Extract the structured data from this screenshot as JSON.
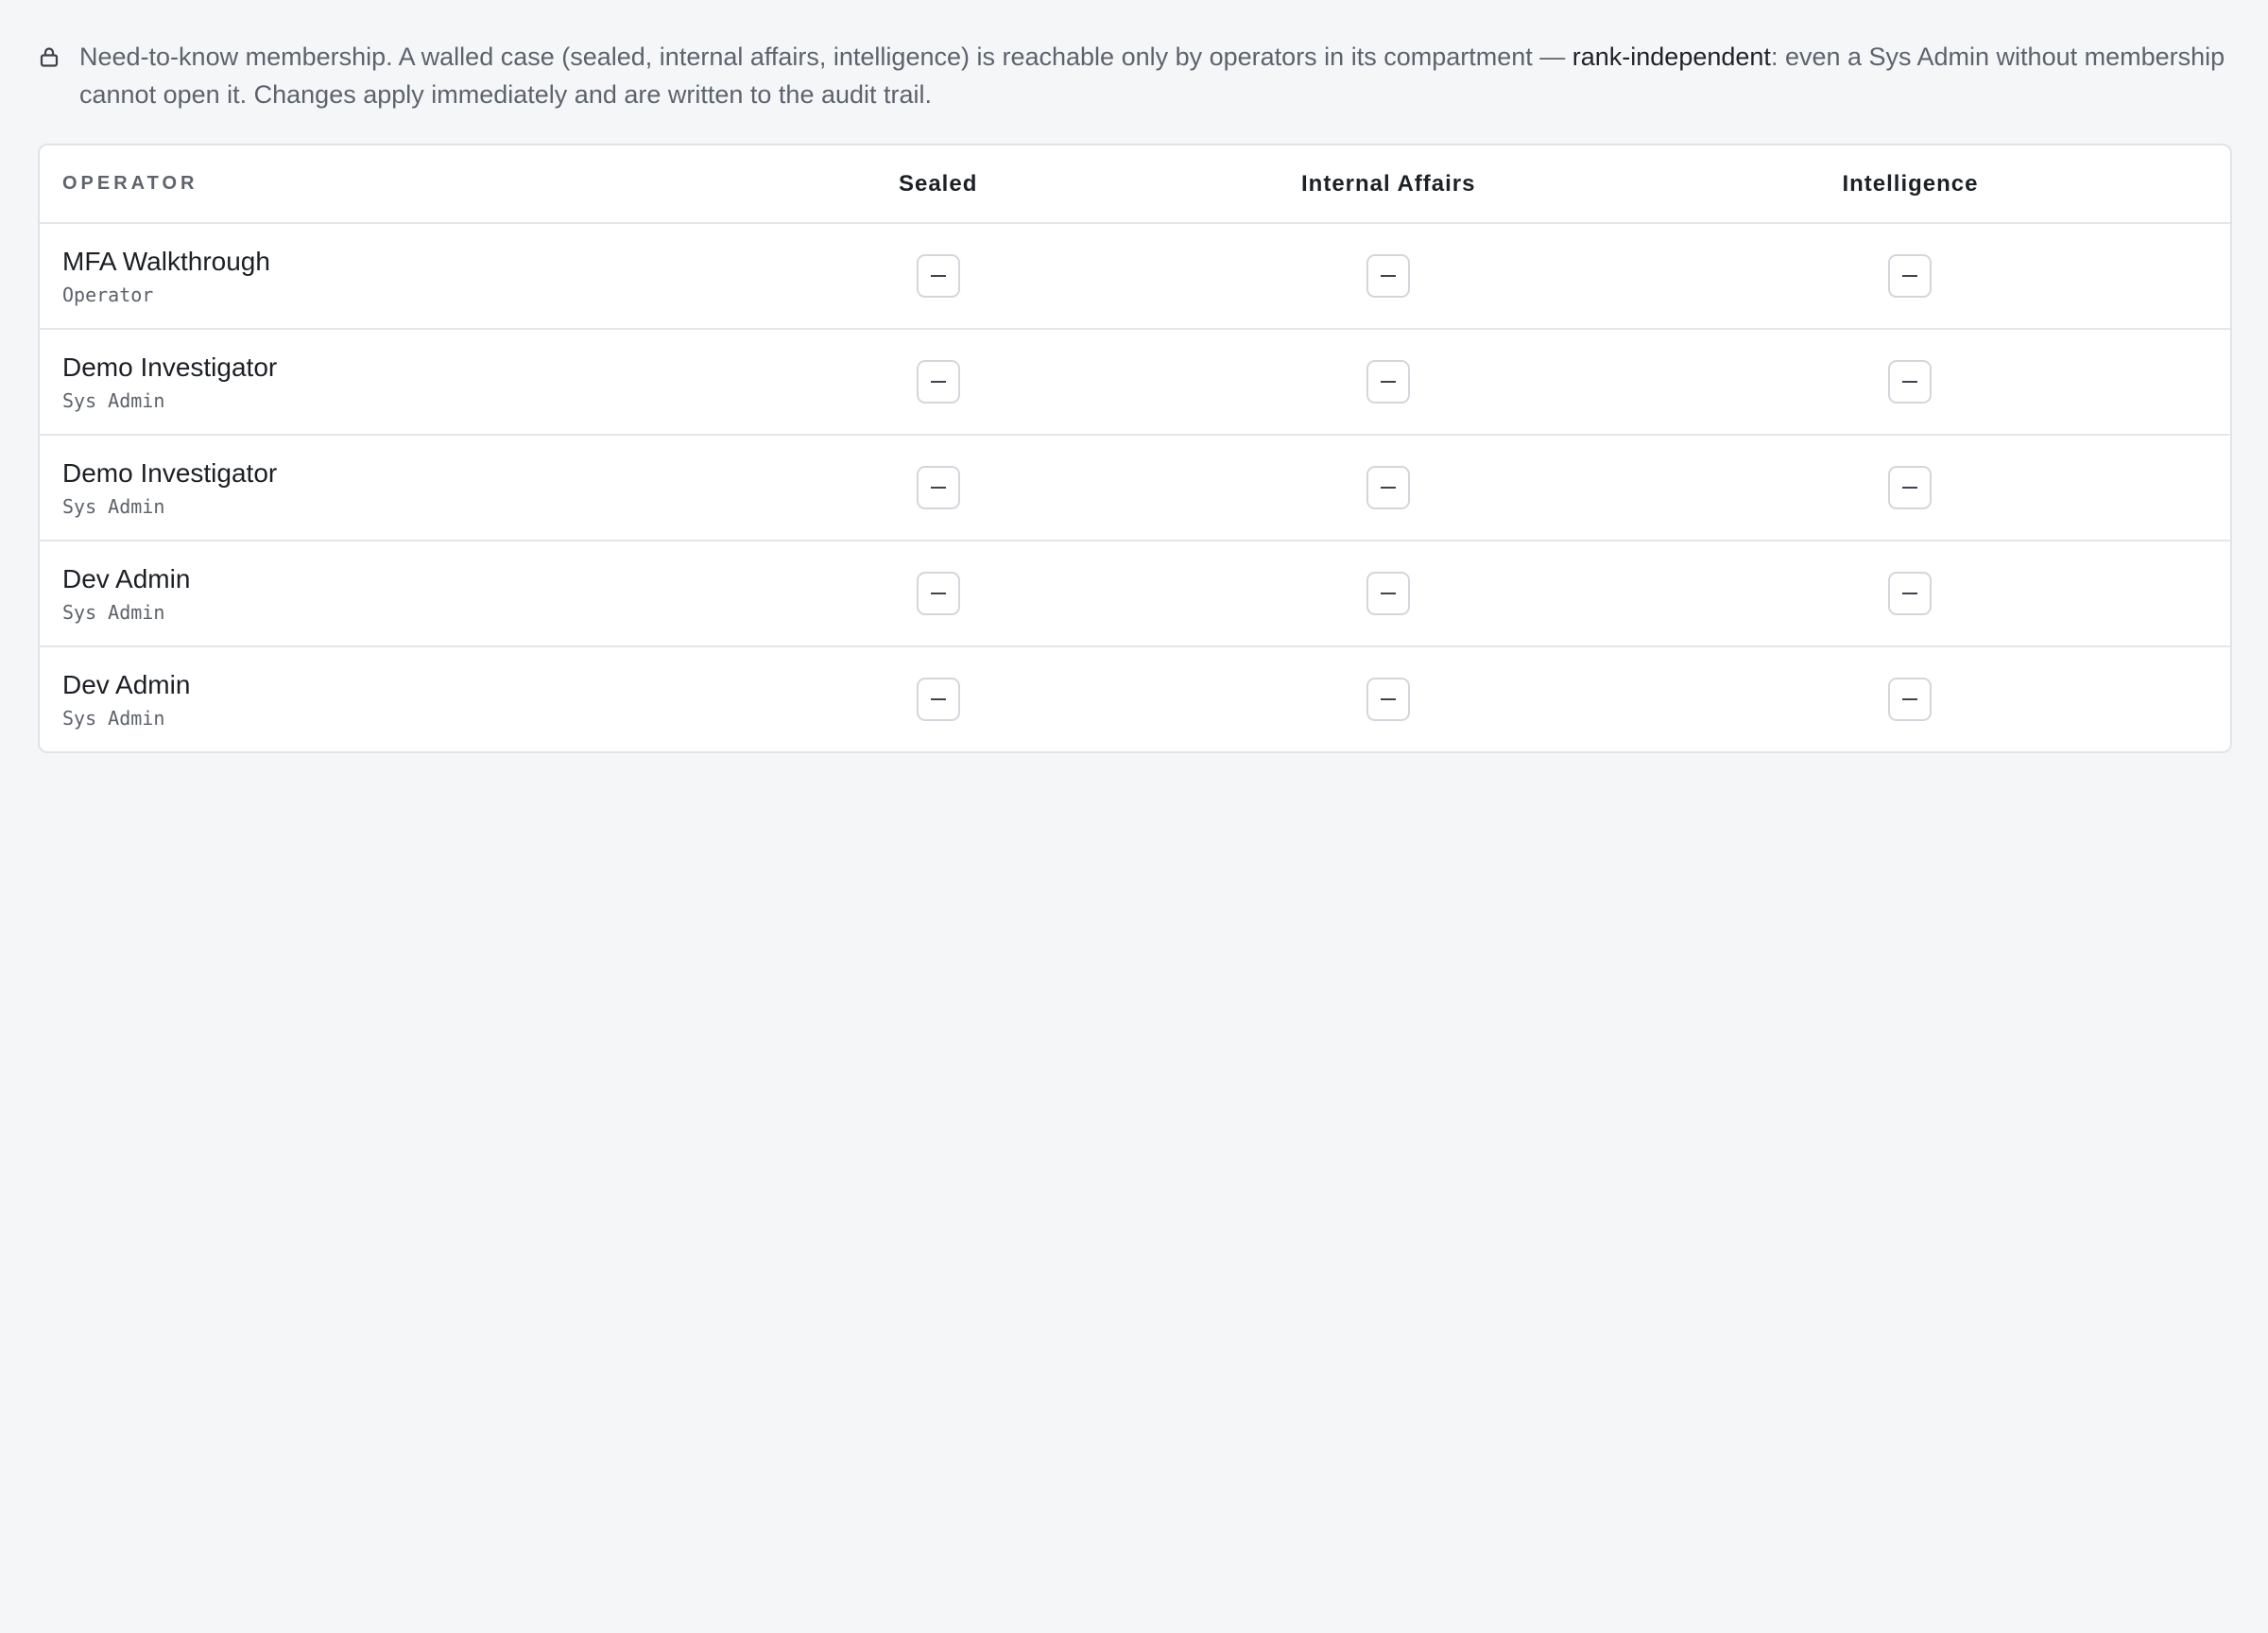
{
  "notice": {
    "text_before": "Need-to-know membership. A walled case (sealed, internal affairs, intelligence) is reachable only by operators in its compartment — ",
    "emphasis": "rank-independent",
    "text_after": ": even a Sys Admin without membership cannot open it. Changes apply immediately and are written to the audit trail.",
    "icon": "lock-icon"
  },
  "table": {
    "headers": {
      "operator": "OPERATOR",
      "sealed": "Sealed",
      "internal_affairs": "Internal Affairs",
      "intelligence": "Intelligence"
    },
    "rows": [
      {
        "name": "MFA Walkthrough",
        "role": "Operator",
        "sealed": "–",
        "internal_affairs": "–",
        "intelligence": "–"
      },
      {
        "name": "Demo Investigator",
        "role": "Sys Admin",
        "sealed": "–",
        "internal_affairs": "–",
        "intelligence": "–"
      },
      {
        "name": "Demo Investigator",
        "role": "Sys Admin",
        "sealed": "–",
        "internal_affairs": "–",
        "intelligence": "–"
      },
      {
        "name": "Dev Admin",
        "role": "Sys Admin",
        "sealed": "–",
        "internal_affairs": "–",
        "intelligence": "–"
      },
      {
        "name": "Dev Admin",
        "role": "Sys Admin",
        "sealed": "–",
        "internal_affairs": "–",
        "intelligence": "–"
      }
    ]
  },
  "colors": {
    "background": "#f5f6f8",
    "card": "#ffffff",
    "border": "#e1e3e7",
    "text_primary": "#1c1f24",
    "text_muted": "#5d636c"
  }
}
